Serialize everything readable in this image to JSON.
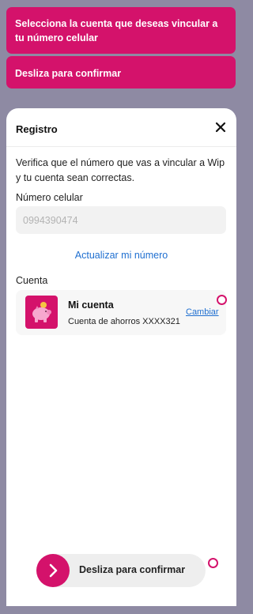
{
  "background_cards": {
    "select_account": "Selecciona la cuenta que deseas vincular a tu número celular",
    "swipe_confirm": "Desliza para confirmar"
  },
  "sheet": {
    "title": "Registro",
    "close_icon": "close-icon",
    "intro": "Verifica que el número que vas a vincular a Wip y tu cuenta sean correctas.",
    "phone_label": "Número celular",
    "phone_placeholder": "0994390474",
    "update_link": "Actualizar mi número",
    "account_label": "Cuenta",
    "account": {
      "icon": "piggy-bank-icon",
      "name": "Mi cuenta",
      "detail": "Cuenta de ahorros XXXX321",
      "change_link": "Cambiar"
    },
    "slider": {
      "icon": "chevron-right-icon",
      "label": "Desliza para confirmar"
    }
  },
  "colors": {
    "brand": "#d4126b",
    "link": "#1f6fd0",
    "overlay": "#8e8aa3"
  }
}
